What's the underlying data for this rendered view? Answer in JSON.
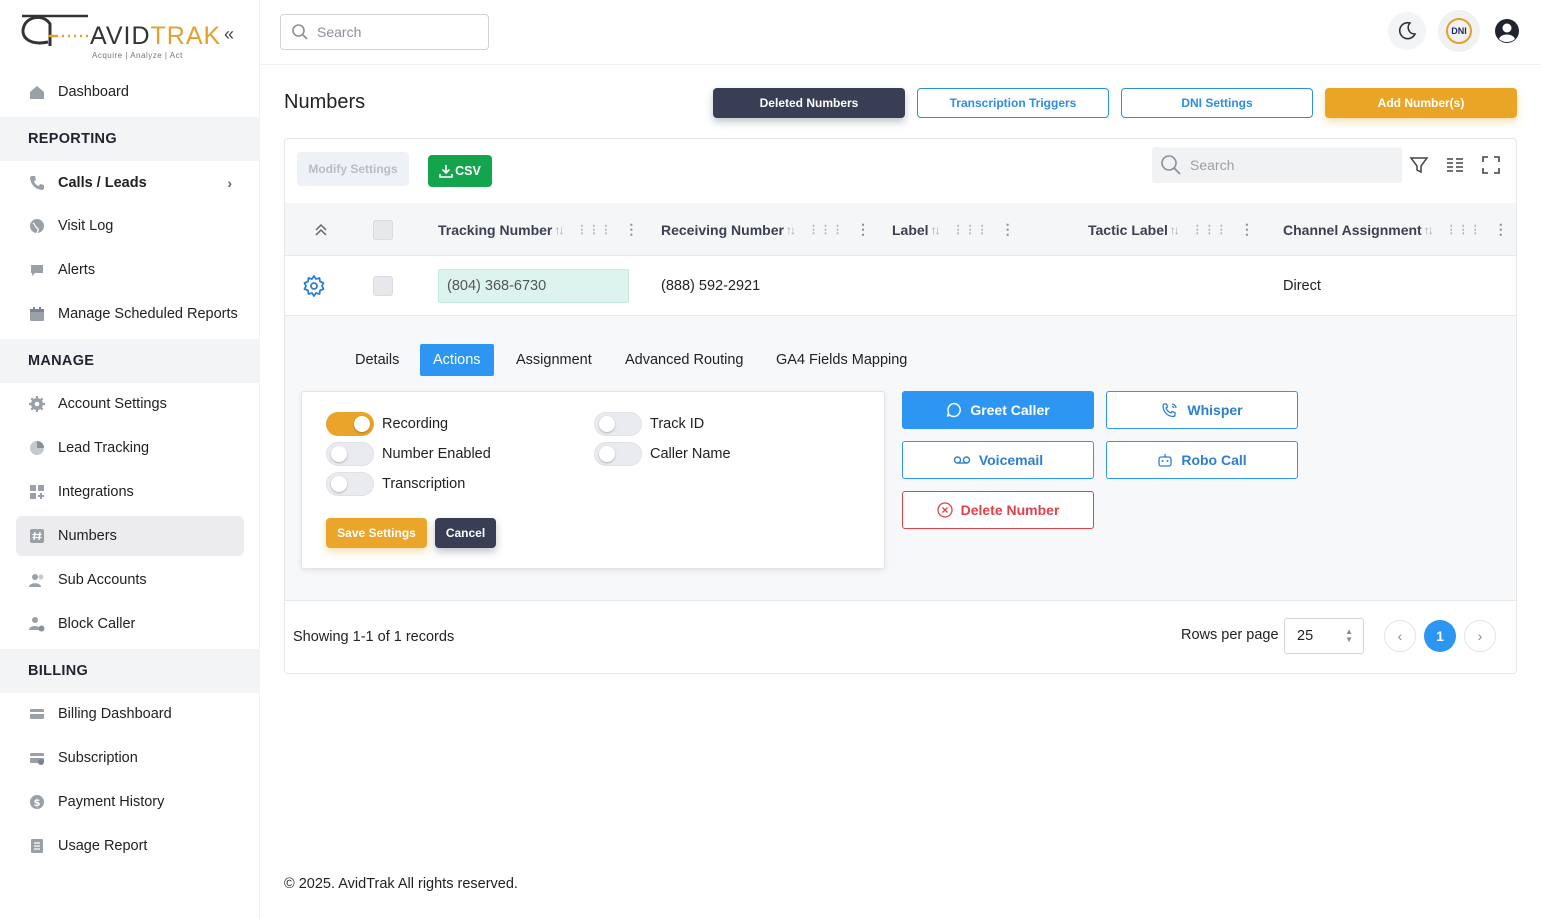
{
  "brand": {
    "name_left": "AVID",
    "name_right": "TRAK",
    "tagline": "Acquire  |  Analyze  |  Act",
    "accent": "#e4a02c",
    "collapse_icon": "double-chevron-left-icon"
  },
  "sidebar": {
    "dashboard": "Dashboard",
    "sections": {
      "reporting": "REPORTING",
      "manage": "MANAGE",
      "billing": "BILLING"
    },
    "reporting_items": [
      {
        "label": "Calls / Leads",
        "icon": "phone-icon"
      },
      {
        "label": "Visit Log",
        "icon": "globe-icon"
      },
      {
        "label": "Alerts",
        "icon": "chat-icon"
      },
      {
        "label": "Manage Scheduled Reports",
        "icon": "calendar-icon"
      }
    ],
    "manage_items": [
      {
        "label": "Account Settings",
        "icon": "gear-icon"
      },
      {
        "label": "Lead Tracking",
        "icon": "pie-chart-icon"
      },
      {
        "label": "Integrations",
        "icon": "grid-plus-icon"
      },
      {
        "label": "Numbers",
        "icon": "hash-icon"
      },
      {
        "label": "Sub Accounts",
        "icon": "users-icon"
      },
      {
        "label": "Block Caller",
        "icon": "user-block-icon"
      }
    ],
    "billing_items": [
      {
        "label": "Billing Dashboard",
        "icon": "card-icon"
      },
      {
        "label": "Subscription",
        "icon": "card-refresh-icon"
      },
      {
        "label": "Payment History",
        "icon": "dollar-icon"
      },
      {
        "label": "Usage Report",
        "icon": "report-icon"
      }
    ],
    "active_item": "Numbers"
  },
  "topbar": {
    "search_placeholder": "Search",
    "dni_label": "DNI"
  },
  "page": {
    "title": "Numbers",
    "buttons": {
      "deleted": "Deleted Numbers",
      "triggers": "Transcription Triggers",
      "dni": "DNI Settings",
      "add": "Add Number(s)"
    }
  },
  "table": {
    "modify_label": "Modify Settings",
    "csv_label": "CSV",
    "search_placeholder": "Search",
    "columns": [
      "Tracking Number",
      "Receiving Number",
      "Label",
      "Tactic Label",
      "Channel Assignment"
    ],
    "rows": [
      {
        "tracking": "(804) 368-6730",
        "receiving": "(888) 592-2921",
        "label": "",
        "tactic": "",
        "channel": "Direct"
      }
    ],
    "showing": "Showing 1-1 of 1 records",
    "rows_per_page_label": "Rows per page",
    "rows_per_page": "25",
    "current_page": "1"
  },
  "detail": {
    "tabs": [
      "Details",
      "Actions",
      "Assignment",
      "Advanced Routing",
      "GA4 Fields Mapping"
    ],
    "active_tab": "Actions",
    "toggles": [
      {
        "label": "Recording",
        "on": true
      },
      {
        "label": "Number Enabled",
        "on": false
      },
      {
        "label": "Transcription",
        "on": false
      },
      {
        "label": "Track ID",
        "on": false
      },
      {
        "label": "Caller Name",
        "on": false
      }
    ],
    "save_label": "Save Settings",
    "cancel_label": "Cancel",
    "actions": {
      "greet": "Greet Caller",
      "whisper": "Whisper",
      "voicemail": "Voicemail",
      "robo": "Robo Call",
      "delete": "Delete Number"
    }
  },
  "footer": {
    "copyright": "© 2025. AvidTrak All rights reserved."
  }
}
